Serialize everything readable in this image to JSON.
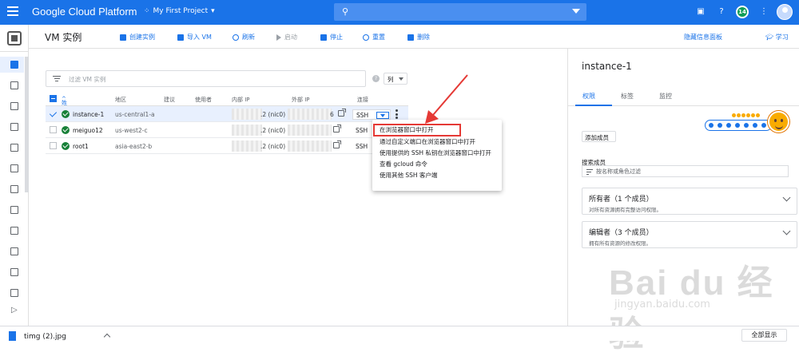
{
  "topbar": {
    "brand": "Google Cloud Platform",
    "project": "My First Project",
    "notification_count": "14"
  },
  "header": {
    "title": "VM 实例",
    "actions": [
      "创建实例",
      "导入 VM",
      "刷新",
      "启动",
      "停止",
      "重置",
      "删除"
    ],
    "hide_panel": "隐藏信息面板",
    "learn": "学习"
  },
  "filter": {
    "placeholder": "过滤 VM 实例",
    "columns_button": "列"
  },
  "table": {
    "headers": [
      "姓名",
      "地区",
      "建议",
      "使用者",
      "内部 IP",
      "外部 IP",
      "连接"
    ],
    "rows": [
      {
        "name": "instance-1",
        "zone": "us-central1-a",
        "internal_ip_suffix": ".2 (nic0)",
        "external_ip_suffix": "6",
        "connect": "SSH"
      },
      {
        "name": "meiguo12",
        "zone": "us-west2-c",
        "internal_ip_suffix": ".2 (nic0)",
        "external_ip_suffix": "",
        "connect": "SSH"
      },
      {
        "name": "root1",
        "zone": "asia-east2-b",
        "internal_ip_suffix": ".2 (nic0)",
        "external_ip_suffix": "",
        "connect": "SSH"
      }
    ]
  },
  "ssh_menu": {
    "items": [
      "在浏览器窗口中打开",
      "通过自定义端口在浏览器窗口中打开",
      "使用提供的 SSH 私钥在浏览器窗口中打开",
      "查看 gcloud 命令",
      "使用其他 SSH 客户端"
    ],
    "highlight_color": "#e53935"
  },
  "panel": {
    "title": "instance-1",
    "tabs": [
      "权限",
      "标签",
      "监控"
    ],
    "add_member": "添加成员",
    "search_label": "搜索成员",
    "search_placeholder": "按名称或角色过滤",
    "roles": [
      {
        "title": "所有者（1 个成员）",
        "desc": "对所有资源拥有完整访问权限。"
      },
      {
        "title": "编辑者（3 个成员）",
        "desc": "拥有所有资源的修改权限。"
      }
    ]
  },
  "watermark": {
    "big": "Bai du 经验",
    "url": "jingyan.baidu.com"
  },
  "download": {
    "file": "timg (2).jpg",
    "show_all": "全部显示"
  },
  "colors": {
    "brand_blue": "#1a73e8",
    "status_green": "#188038"
  }
}
